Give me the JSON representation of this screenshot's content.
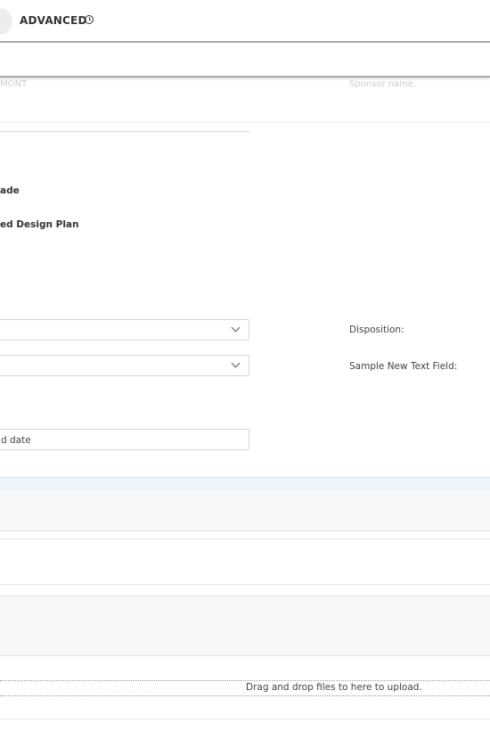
{
  "header": {
    "advanced_label": "ADVANCED"
  },
  "form": {
    "truncated_faint_text": "MONT",
    "sponsor_name_placeholder": "Sponsor name.",
    "option_1": "ade",
    "option_2": "ed Design Plan",
    "disposition_label": "Disposition:",
    "sample_text_field_label": "Sample New Text Field:",
    "date_field_value": "d date"
  },
  "upload": {
    "drop_hint": "Drag and drop files to here to upload."
  },
  "colors": {
    "section_band": "#eef5fb",
    "panel_band": "#f7f8f9",
    "border": "#d6d6d6"
  }
}
